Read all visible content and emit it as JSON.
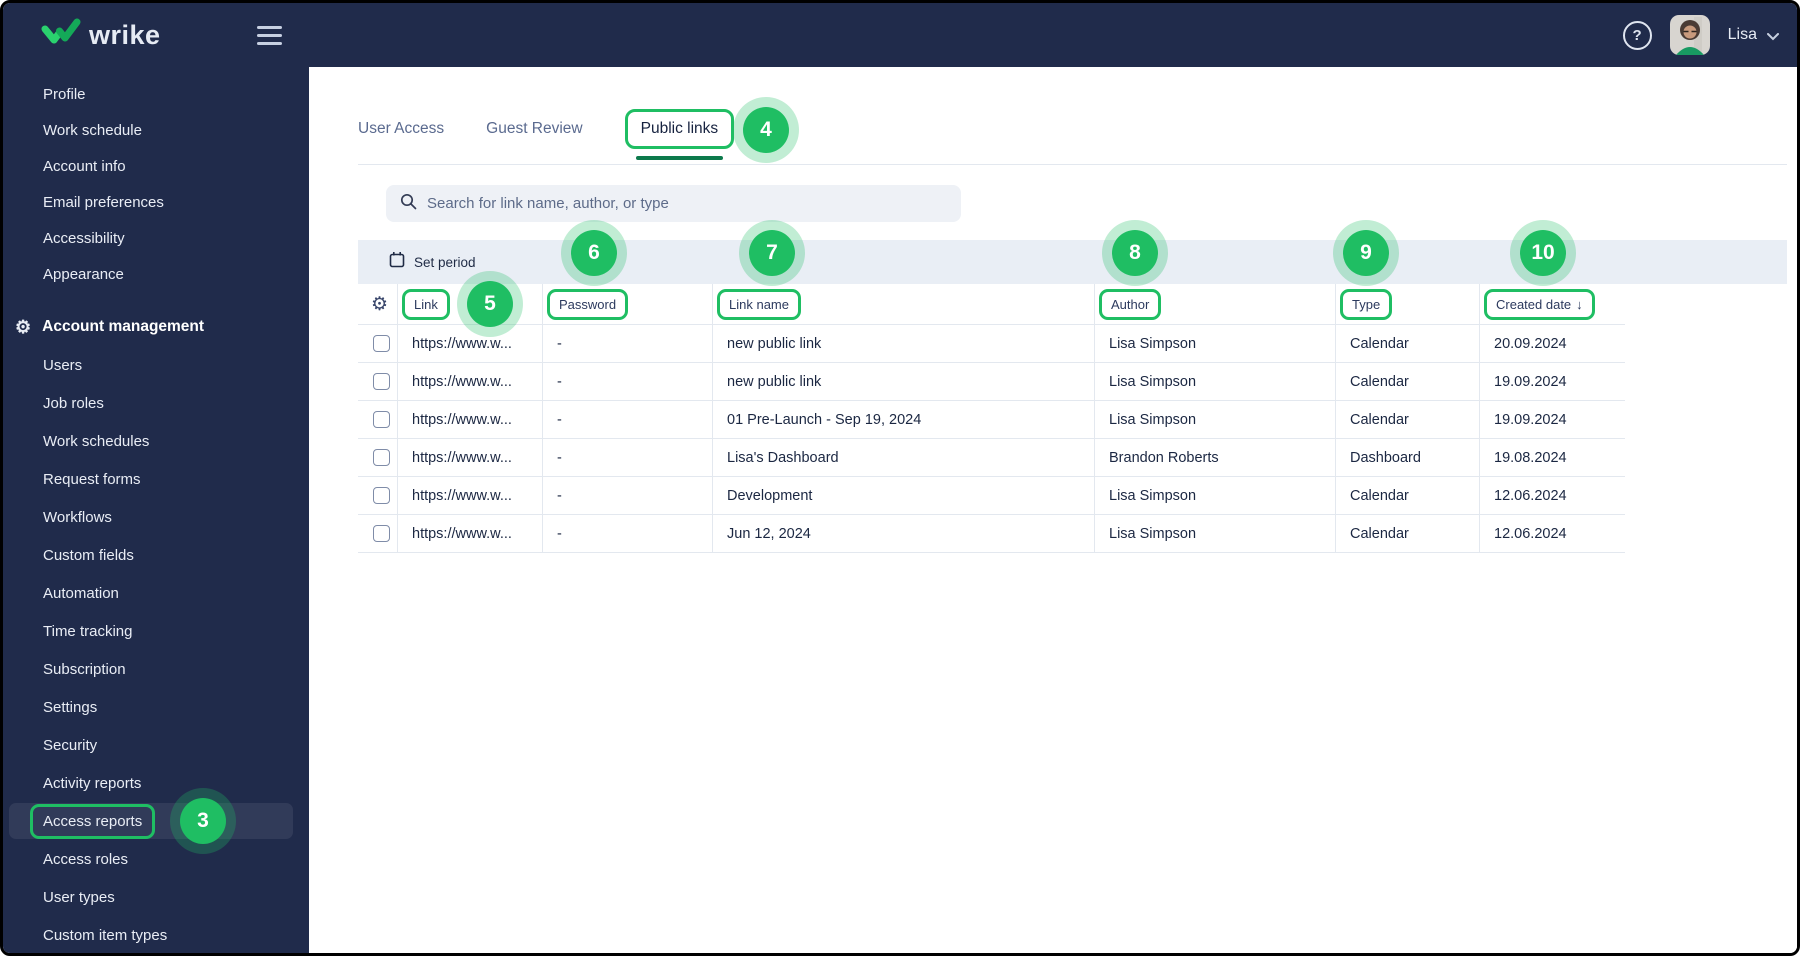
{
  "topbar": {
    "logo_text": "wrike",
    "user_name": "Lisa",
    "help_icon": "?"
  },
  "sidebar": {
    "top_items": [
      "Profile",
      "Work schedule",
      "Account info",
      "Email preferences",
      "Accessibility",
      "Appearance"
    ],
    "section_label": "Account management",
    "section_icon": "⚙",
    "management_items": [
      "Users",
      "Job roles",
      "Work schedules",
      "Request forms",
      "Workflows",
      "Custom fields",
      "Automation",
      "Time tracking",
      "Subscription",
      "Settings",
      "Security",
      "Activity reports",
      "Access reports",
      "Access roles",
      "User types",
      "Custom item types"
    ],
    "active_item": "Access reports"
  },
  "tabs": {
    "items": [
      "User Access",
      "Guest Review",
      "Public links"
    ],
    "active": "Public links"
  },
  "search": {
    "placeholder": "Search for link name, author, or type"
  },
  "toolbar": {
    "set_period_label": "Set period"
  },
  "table": {
    "settings_icon": "⚙",
    "columns": [
      "Link",
      "Password",
      "Link name",
      "Author",
      "Type",
      "Created date"
    ],
    "sort": {
      "column": "Created date",
      "direction": "desc",
      "arrow": "↓"
    },
    "rows": [
      {
        "link": "https://www.w...",
        "password": "-",
        "name": "new public link",
        "author": "Lisa Simpson",
        "type": "Calendar",
        "created": "20.09.2024"
      },
      {
        "link": "https://www.w...",
        "password": "-",
        "name": "new public link",
        "author": "Lisa Simpson",
        "type": "Calendar",
        "created": "19.09.2024"
      },
      {
        "link": "https://www.w...",
        "password": "-",
        "name": "01 Pre-Launch - Sep 19, 2024",
        "author": "Lisa Simpson",
        "type": "Calendar",
        "created": "19.09.2024"
      },
      {
        "link": "https://www.w...",
        "password": "-",
        "name": "Lisa's Dashboard",
        "author": "Brandon Roberts",
        "type": "Dashboard",
        "created": "19.08.2024"
      },
      {
        "link": "https://www.w...",
        "password": "-",
        "name": "Development",
        "author": "Lisa Simpson",
        "type": "Calendar",
        "created": "12.06.2024"
      },
      {
        "link": "https://www.w...",
        "password": "-",
        "name": "Jun 12, 2024",
        "author": "Lisa Simpson",
        "type": "Calendar",
        "created": "12.06.2024"
      }
    ]
  },
  "annotations": {
    "badge_numbers": [
      "3",
      "4",
      "5",
      "6",
      "7",
      "8",
      "9",
      "10"
    ]
  },
  "colors": {
    "accent_green": "#1fbe63",
    "badge_halo": "rgba(31,190,99,0.28)",
    "active_tab_underline": "#0d7a4c",
    "sidebar_bg": "#202b4b",
    "table_border": "#e3e8ef",
    "filter_bar_bg": "#e9eef5",
    "search_bg": "#eef1f6"
  }
}
